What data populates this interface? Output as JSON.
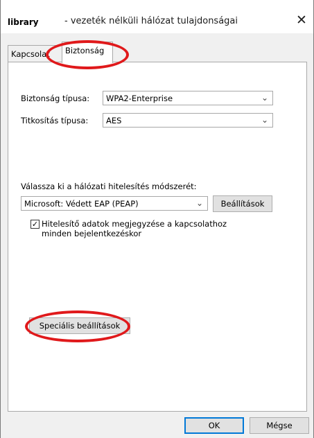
{
  "title": {
    "prefix": "library",
    "text": "- vezeték nélküli hálózat tulajdonságai",
    "close": "✕"
  },
  "tabs": [
    {
      "label": "Kapcsolat"
    },
    {
      "label": "Biztonság"
    }
  ],
  "security": {
    "type_label": "Biztonság típusa:",
    "type_value": "WPA2-Enterprise",
    "encryption_label": "Titkosítás típusa:",
    "encryption_value": "AES"
  },
  "auth": {
    "method_prompt": "Válassza ki a hálózati hitelesítés módszerét:",
    "method_value": "Microsoft: Védett EAP (PEAP)",
    "settings_button": "Beállítások",
    "remember_checkbox_line1": "Hitelesítő adatok megjegyzése a kapcsolathoz",
    "remember_checkbox_line2": "minden bejelentkezéskor",
    "remember_checked": true
  },
  "advanced_button": "Speciális beállítások",
  "footer": {
    "ok": "OK",
    "cancel": "Mégse"
  }
}
